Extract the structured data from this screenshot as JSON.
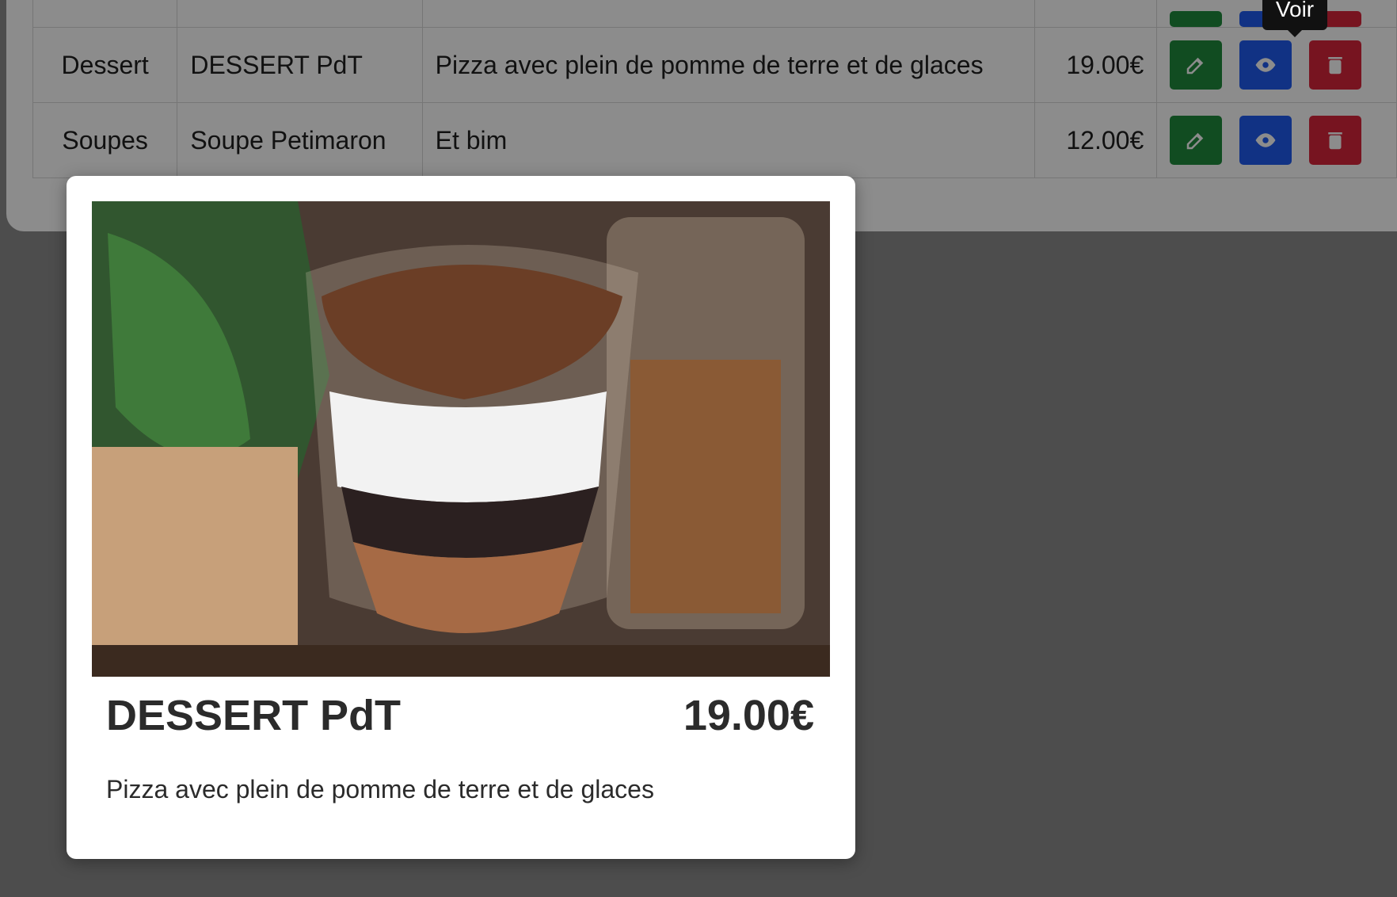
{
  "table": {
    "rows": [
      {
        "category": "",
        "name": "",
        "description": "",
        "price": ""
      },
      {
        "category": "Dessert",
        "name": "DESSERT PdT",
        "description": "Pizza avec plein de pomme de terre et de glaces",
        "price": "19.00€"
      },
      {
        "category": "Soupes",
        "name": "Soupe Petimaron",
        "description": "Et bim",
        "price": "12.00€"
      }
    ],
    "actions": {
      "edit_icon": "edit-icon",
      "view_icon": "eye-icon",
      "delete_icon": "trash-icon"
    }
  },
  "tooltip": {
    "label": "Voir"
  },
  "modal": {
    "title": "DESSERT PdT",
    "price": "19.00€",
    "description": "Pizza avec plein de pomme de terre et de glaces",
    "image_icon": "dessert-photo"
  },
  "colors": {
    "edit": "#1f8a3d",
    "view": "#1f5cf0",
    "delete": "#d9263b",
    "overlay": "rgba(0,0,0,0.45)"
  }
}
